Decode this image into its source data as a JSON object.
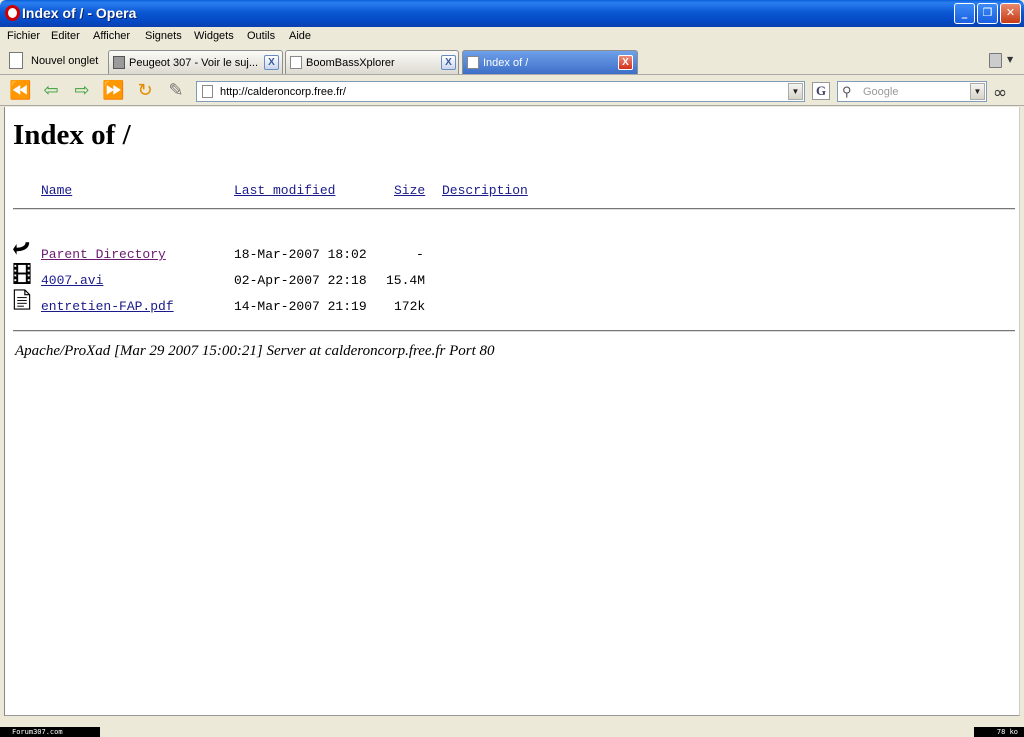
{
  "window": {
    "title": "Index of / - Opera",
    "min_glyph": "_",
    "max_glyph": "❐",
    "close_glyph": "✕"
  },
  "menu": [
    "Fichier",
    "Editer",
    "Afficher",
    "Signets",
    "Widgets",
    "Outils",
    "Aide"
  ],
  "tabs": {
    "new_tab_label": "Nouvel onglet",
    "items": [
      {
        "label": "Peugeot 307 - Voir le suj...",
        "icon": "tool-icon",
        "active": false
      },
      {
        "label": "BoomBassXplorer",
        "icon": "page-icon",
        "active": false
      },
      {
        "label": "Index of /",
        "icon": "page-icon",
        "active": true
      }
    ],
    "close_glyph": "X"
  },
  "toolbar": {
    "url": "http://calderoncorp.free.fr/",
    "search_placeholder": "Google",
    "g_glyph": "G",
    "glasses_glyph": "∞",
    "nav_icons": {
      "rewind": "⏪",
      "back": "⇦",
      "forward": "⇨",
      "fast_forward": "⏩",
      "reload": "↻",
      "edit": "✎",
      "dropdown": "▼",
      "search": "⚲"
    }
  },
  "page": {
    "heading": "Index of /",
    "columns": {
      "name": "Name",
      "modified": "Last modified",
      "size": "Size",
      "description": "Description"
    },
    "rows": [
      {
        "name": "Parent Directory",
        "modified": "18-Mar-2007 18:02",
        "size": "-",
        "icon": "back-arrow-icon",
        "visited": true
      },
      {
        "name": "4007.avi",
        "modified": "02-Apr-2007 22:18",
        "size": "15.4M",
        "icon": "film-icon",
        "visited": false
      },
      {
        "name": "entretien-FAP.pdf",
        "modified": "14-Mar-2007 21:19",
        "size": "172k",
        "icon": "document-icon",
        "visited": false
      }
    ],
    "server_signature": "Apache/ProXad [Mar 29 2007 15:00:21] Server at calderoncorp.free.fr Port 80"
  },
  "status": {
    "left": "Forum307.com",
    "right": "78 ko"
  },
  "colors": {
    "title_bar": "#0b58d4",
    "link": "#1a1a8c",
    "visited_link": "#6b1a70",
    "active_tab": "#3d6fc8"
  }
}
